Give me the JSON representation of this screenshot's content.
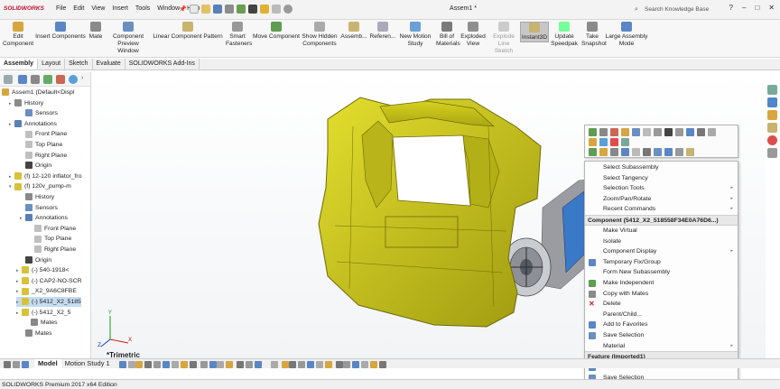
{
  "app": {
    "logo": "SOLIDWORKS",
    "document_title": "Assem1 *",
    "search_placeholder": "Search Knowledge Base",
    "status_text": "SOLIDWORKS Premium 2017 x64 Edition"
  },
  "menu": [
    "File",
    "Edit",
    "View",
    "Insert",
    "Tools",
    "Window",
    "Help"
  ],
  "commands": [
    {
      "label": "Edit Component",
      "icon": "edit-component-icon",
      "enabled": true
    },
    {
      "label": "Insert Components",
      "icon": "insert-components-icon",
      "enabled": true
    },
    {
      "label": "Mate",
      "icon": "mate-icon",
      "enabled": true
    },
    {
      "label": "Component Preview Window",
      "icon": "preview-window-icon",
      "enabled": true
    },
    {
      "label": "Linear Component Pattern",
      "icon": "linear-pattern-icon",
      "enabled": true
    },
    {
      "label": "Smart Fasteners",
      "icon": "smart-fasteners-icon",
      "enabled": true
    },
    {
      "label": "Move Component",
      "icon": "move-component-icon",
      "enabled": true
    },
    {
      "label": "Show Hidden Components",
      "icon": "show-hidden-icon",
      "enabled": true
    },
    {
      "label": "Assemb...",
      "icon": "assembly-features-icon",
      "enabled": true
    },
    {
      "label": "Referen...",
      "icon": "reference-geometry-icon",
      "enabled": true
    },
    {
      "label": "New Motion Study",
      "icon": "motion-study-icon",
      "enabled": true
    },
    {
      "label": "Bill of Materials",
      "icon": "bom-icon",
      "enabled": true
    },
    {
      "label": "Exploded View",
      "icon": "exploded-view-icon",
      "enabled": true
    },
    {
      "label": "Explode Line Sketch",
      "icon": "explode-line-icon",
      "enabled": false
    },
    {
      "label": "Instant3D",
      "icon": "instant3d-icon",
      "enabled": true,
      "active": true
    },
    {
      "label": "Update Speedpak",
      "icon": "speedpak-icon",
      "enabled": true
    },
    {
      "label": "Take Snapshot",
      "icon": "snapshot-icon",
      "enabled": true
    },
    {
      "label": "Large Assembly Mode",
      "icon": "large-assembly-icon",
      "enabled": true
    }
  ],
  "tabs": [
    {
      "label": "Assembly",
      "active": true
    },
    {
      "label": "Layout",
      "active": false
    },
    {
      "label": "Sketch",
      "active": false
    },
    {
      "label": "Evaluate",
      "active": false
    },
    {
      "label": "SOLIDWORKS Add-Ins",
      "active": false
    }
  ],
  "tree": [
    {
      "label": "Assem1  (Default<Displ",
      "icon": "assembly-icon",
      "expand": ""
    },
    {
      "label": "History",
      "icon": "history-icon",
      "expand": "▸"
    },
    {
      "label": "Sensors",
      "icon": "sensors-icon",
      "expand": ""
    },
    {
      "label": "Annotations",
      "icon": "annotations-icon",
      "expand": "▸"
    },
    {
      "label": "Front Plane",
      "icon": "plane-icon",
      "expand": ""
    },
    {
      "label": "Top Plane",
      "icon": "plane-icon",
      "expand": ""
    },
    {
      "label": "Right Plane",
      "icon": "plane-icon",
      "expand": ""
    },
    {
      "label": "Origin",
      "icon": "origin-icon",
      "expand": ""
    },
    {
      "label": "(f) 12-120 inflator_fro",
      "icon": "part-icon",
      "expand": "▸"
    },
    {
      "label": "(f) 120v_pump-m",
      "icon": "part-icon",
      "expand": "▾"
    },
    {
      "label": "History",
      "icon": "history-icon",
      "expand": ""
    },
    {
      "label": "Sensors",
      "icon": "sensors-icon",
      "expand": ""
    },
    {
      "label": "Annotations",
      "icon": "annotations-icon",
      "expand": "▸"
    },
    {
      "label": "Front Plane",
      "icon": "plane-icon",
      "expand": ""
    },
    {
      "label": "Top Plane",
      "icon": "plane-icon",
      "expand": ""
    },
    {
      "label": "Right Plane",
      "icon": "plane-icon",
      "expand": ""
    },
    {
      "label": "Origin",
      "icon": "origin-icon",
      "expand": ""
    },
    {
      "label": "(-) 540-1918<",
      "icon": "part-icon",
      "expand": "▸"
    },
    {
      "label": "(-) CAP2-NO-SCR",
      "icon": "part-icon",
      "expand": "▸"
    },
    {
      "label": "_X2_9A6C8FBE",
      "icon": "part-icon",
      "expand": "▸"
    },
    {
      "label": "(-) 5412_X2_5185",
      "icon": "part-icon",
      "expand": "▸",
      "selected": true
    },
    {
      "label": "(-) 5412_X2_5",
      "icon": "part-icon",
      "expand": "▸"
    },
    {
      "label": "Mates",
      "icon": "mates-icon",
      "expand": ""
    },
    {
      "label": "Mates",
      "icon": "mates-icon",
      "expand": ""
    }
  ],
  "viewport": {
    "view_label": "*Trimetric",
    "model_color": "#c8c418",
    "model_edge_color": "#6e6a08"
  },
  "context_menu": {
    "items": [
      {
        "type": "item",
        "label": "Select Subassembly",
        "icon": ""
      },
      {
        "type": "item",
        "label": "Select Tangency",
        "icon": ""
      },
      {
        "type": "item",
        "label": "Selection Tools",
        "icon": "",
        "submenu": true
      },
      {
        "type": "item",
        "label": "Zoom/Pan/Rotate",
        "icon": "",
        "submenu": true
      },
      {
        "type": "item",
        "label": "Recent Commands",
        "icon": "",
        "submenu": true
      },
      {
        "type": "header",
        "label": "Component (5412_X2_518558F34E0A76D6...)"
      },
      {
        "type": "item",
        "label": "Make Virtual",
        "icon": ""
      },
      {
        "type": "item",
        "label": "Isolate",
        "icon": ""
      },
      {
        "type": "item",
        "label": "Component Display",
        "icon": "",
        "submenu": true
      },
      {
        "type": "item",
        "label": "Temporary Fix/Group",
        "icon": "fix-icon"
      },
      {
        "type": "item",
        "label": "Form New Subassembly",
        "icon": ""
      },
      {
        "type": "item",
        "label": "Make Independent",
        "icon": "independent-icon"
      },
      {
        "type": "item",
        "label": "Copy with Mates",
        "icon": "copy-mates-icon"
      },
      {
        "type": "item",
        "label": "Delete",
        "icon": "delete-icon"
      },
      {
        "type": "item",
        "label": "Parent/Child...",
        "icon": ""
      },
      {
        "type": "item",
        "label": "Add to Favorites",
        "icon": "favorites-icon"
      },
      {
        "type": "item",
        "label": "Save Selection",
        "icon": "save-selection-icon"
      },
      {
        "type": "item",
        "label": "Material",
        "icon": "",
        "submenu": true
      },
      {
        "type": "header",
        "label": "Feature (Imported1)"
      },
      {
        "type": "item",
        "label": "Add to Favorites",
        "icon": "favorites-icon"
      },
      {
        "type": "item",
        "label": "Save Selection",
        "icon": "save-selection-icon"
      }
    ]
  },
  "bottom_tabs": [
    {
      "label": "Model",
      "active": true
    },
    {
      "label": "Motion Study 1",
      "active": false
    }
  ],
  "colors": {
    "accent_red": "#c8102e",
    "selection_blue": "#c5dcf2",
    "delete_red": "#d02020"
  }
}
